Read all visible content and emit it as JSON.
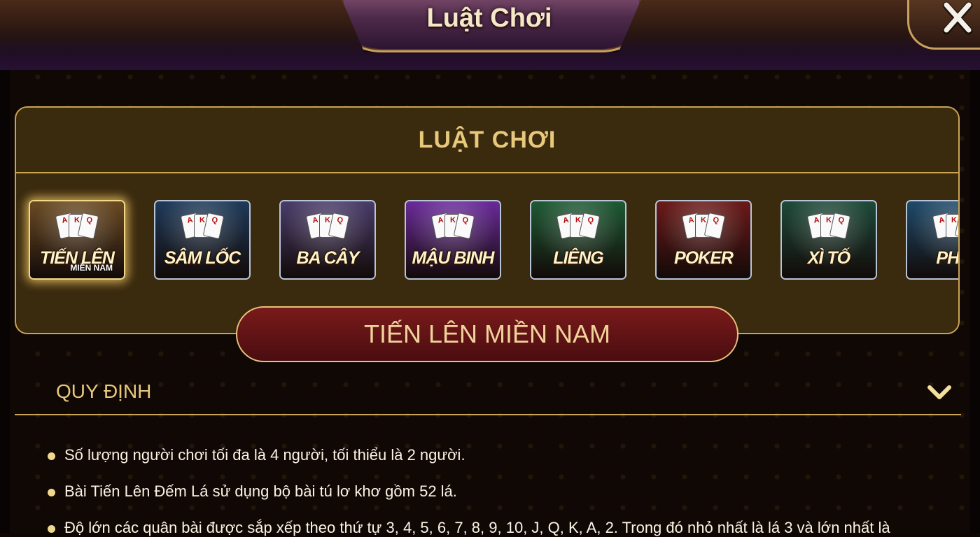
{
  "window": {
    "title": "Luật Chơi",
    "close_icon": "close-icon"
  },
  "panel": {
    "header": "LUẬT CHƠI"
  },
  "games": [
    {
      "label": "TIẾN LÊN",
      "sublabel": "MIỀN NAM",
      "selected": true,
      "color": "#6a4a22"
    },
    {
      "label": "SÂM LỐC",
      "sublabel": "",
      "selected": false,
      "color": "#1e3a5a"
    },
    {
      "label": "BA CÂY",
      "sublabel": "",
      "selected": false,
      "color": "#4a3c6a"
    },
    {
      "label": "MẬU BINH",
      "sublabel": "",
      "selected": false,
      "color": "#6a2a9a"
    },
    {
      "label": "LIÊNG",
      "sublabel": "",
      "selected": false,
      "color": "#1e5a34"
    },
    {
      "label": "POKER",
      "sublabel": "",
      "selected": false,
      "color": "#6a1a18"
    },
    {
      "label": "XÌ TỐ",
      "sublabel": "",
      "selected": false,
      "color": "#1e4a3a"
    },
    {
      "label": "PHỎ",
      "sublabel": "",
      "selected": false,
      "color": "#1e4a6a"
    }
  ],
  "selected_game_title": "TIẾN LÊN MIỀN NAM",
  "section": {
    "title": "QUY ĐỊNH",
    "toggle_icon": "chevron-down-icon"
  },
  "rules": [
    "Số lượng người chơi tối đa là 4 người, tối thiểu là 2 người.",
    "Bài Tiến Lên Đếm Lá sử dụng bộ bài tú lơ khơ gồm 52 lá.",
    "Độ lớn các quân bài được sắp xếp theo thứ tự 3, 4, 5, 6, 7, 8, 9, 10, J, Q, K, A, 2. Trong đó nhỏ nhất là lá 3 và lớn nhất là"
  ],
  "colors": {
    "gold": "#c8a453",
    "gold_text": "#e8c87a",
    "pill_red": "#6a1418",
    "panel_bg": "#3a2a0e"
  }
}
